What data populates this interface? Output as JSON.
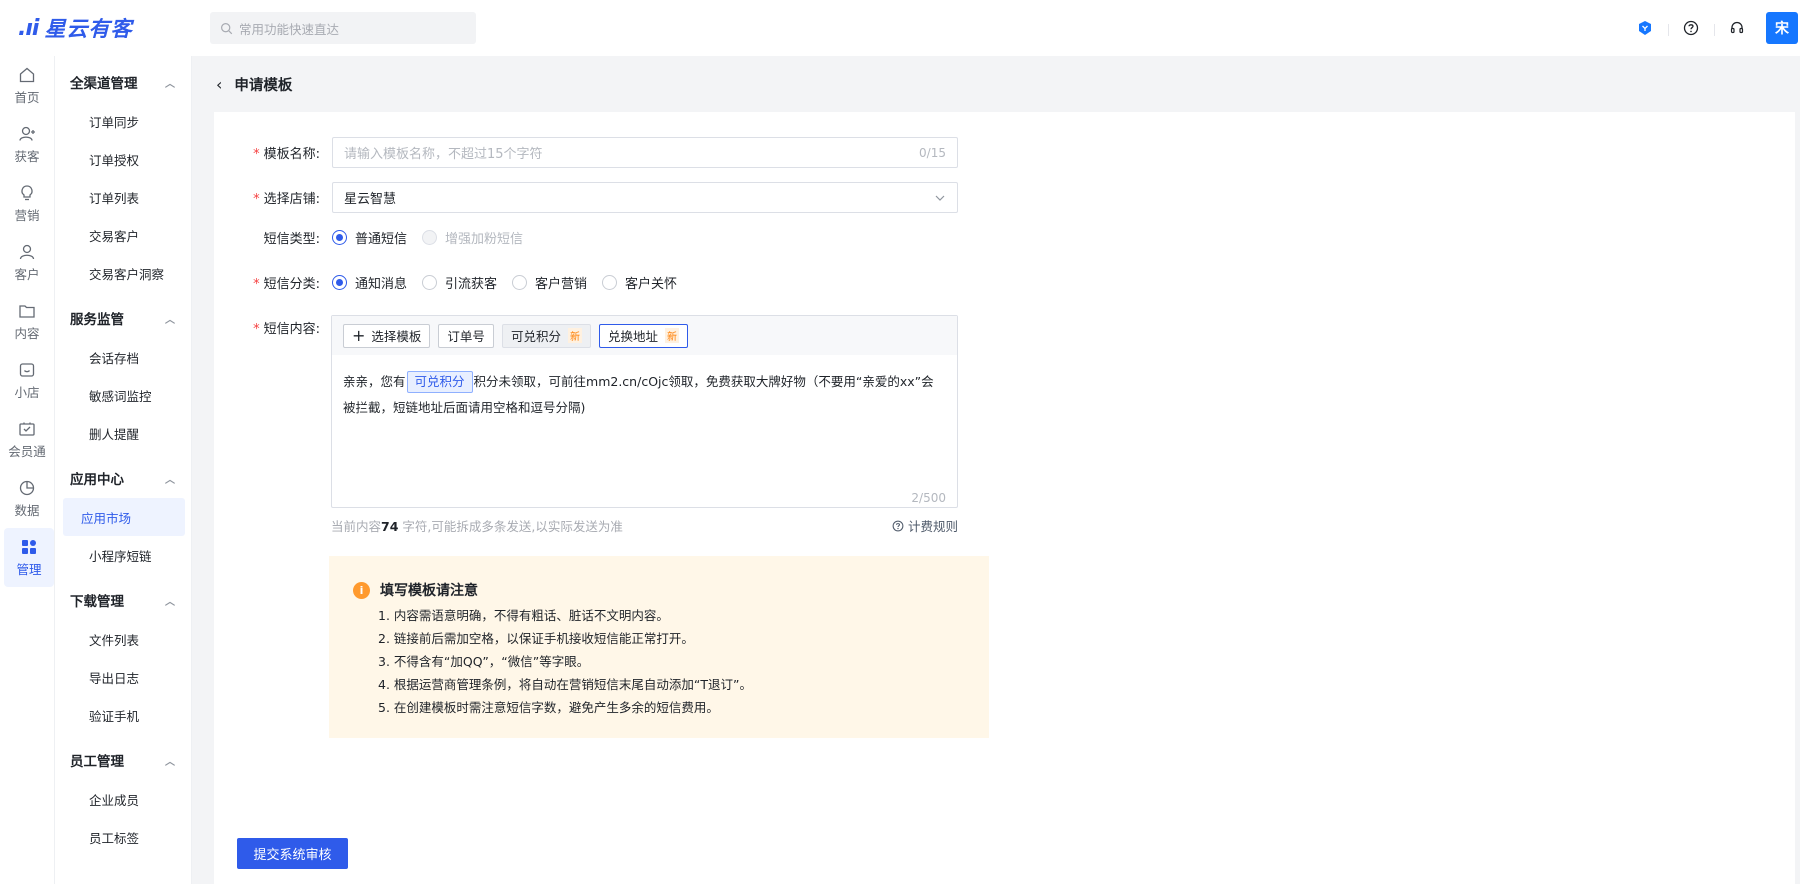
{
  "brand": {
    "mark": ".ıi",
    "name": "星云有客"
  },
  "search": {
    "placeholder": "常用功能快速直达"
  },
  "user": {
    "avatar_text": "宋"
  },
  "rail": [
    {
      "icon": "home-icon",
      "label": "首页"
    },
    {
      "icon": "user-add-icon",
      "label": "获客"
    },
    {
      "icon": "bulb-icon",
      "label": "营销"
    },
    {
      "icon": "person-icon",
      "label": "客户"
    },
    {
      "icon": "folder-icon",
      "label": "内容"
    },
    {
      "icon": "shop-icon",
      "label": "小店"
    },
    {
      "icon": "member-icon",
      "label": "会员通"
    },
    {
      "icon": "pie-chart-icon",
      "label": "数据"
    },
    {
      "icon": "grid-icon",
      "label": "管理"
    }
  ],
  "subnav": {
    "groups": [
      {
        "title": "全渠道管理",
        "items": [
          "订单同步",
          "订单授权",
          "订单列表",
          "交易客户",
          "交易客户洞察"
        ]
      },
      {
        "title": "服务监管",
        "items": [
          "会话存档",
          "敏感词监控",
          "删人提醒"
        ]
      },
      {
        "title": "应用中心",
        "items": [
          "应用市场",
          "小程序短链"
        ]
      },
      {
        "title": "下载管理",
        "items": [
          "文件列表",
          "导出日志",
          "验证手机"
        ]
      },
      {
        "title": "员工管理",
        "items": [
          "企业成员",
          "员工标签"
        ]
      }
    ],
    "active_item": "应用市场"
  },
  "page": {
    "title": "申请模板"
  },
  "form": {
    "name": {
      "label": "模板名称:",
      "placeholder": "请输入模板名称，不超过15个字符",
      "count": "0/15"
    },
    "store": {
      "label": "选择店铺:",
      "value": "星云智慧"
    },
    "sms_type": {
      "label": "短信类型:",
      "options": [
        "普通短信",
        "增强加粉短信"
      ],
      "selected": "普通短信",
      "disabled": "增强加粉短信"
    },
    "category": {
      "label": "短信分类:",
      "options": [
        "通知消息",
        "引流获客",
        "客户营销",
        "客户关怀"
      ],
      "selected": "通知消息"
    },
    "content": {
      "label": "短信内容:",
      "toolbar": {
        "select_template": "选择模板",
        "order_no": "订单号",
        "points": "可兑积分",
        "address": "兑换地址",
        "new_badge": "新"
      },
      "text_before": "亲亲，您有",
      "tag": "可兑积分",
      "text_after": "积分未领取，可前往mm2.cn/cOjc领取，免费获取大牌好物（不要用“亲爱的xx”会被拦截，短链地址后面请用空格和逗号分隔)",
      "count": "2/500"
    },
    "hint": {
      "prefix": "当前内容",
      "chars": "74",
      "suffix": " 字符,可能拆成多条发送,以实际发送为准",
      "rule": "计费规则"
    }
  },
  "notice": {
    "title": "填写模板请注意",
    "items": [
      "1. 内容需语意明确，不得有粗话、脏话不文明内容。",
      "2. 链接前后需加空格，以保证手机接收短信能正常打开。",
      "3. 不得含有“加QQ”，“微信”等字眼。",
      "4. 根据运营商管理条例，将自动在营销短信末尾自动添加“T退订”。",
      "5. 在创建模板时需注意短信字数，避免产生多余的短信费用。"
    ]
  },
  "submit_label": "提交系统审核",
  "colors": {
    "primary": "#2f5bea",
    "required": "#f53f3f",
    "notice_bg": "#fff7e8",
    "warn": "#ff9a2e"
  }
}
